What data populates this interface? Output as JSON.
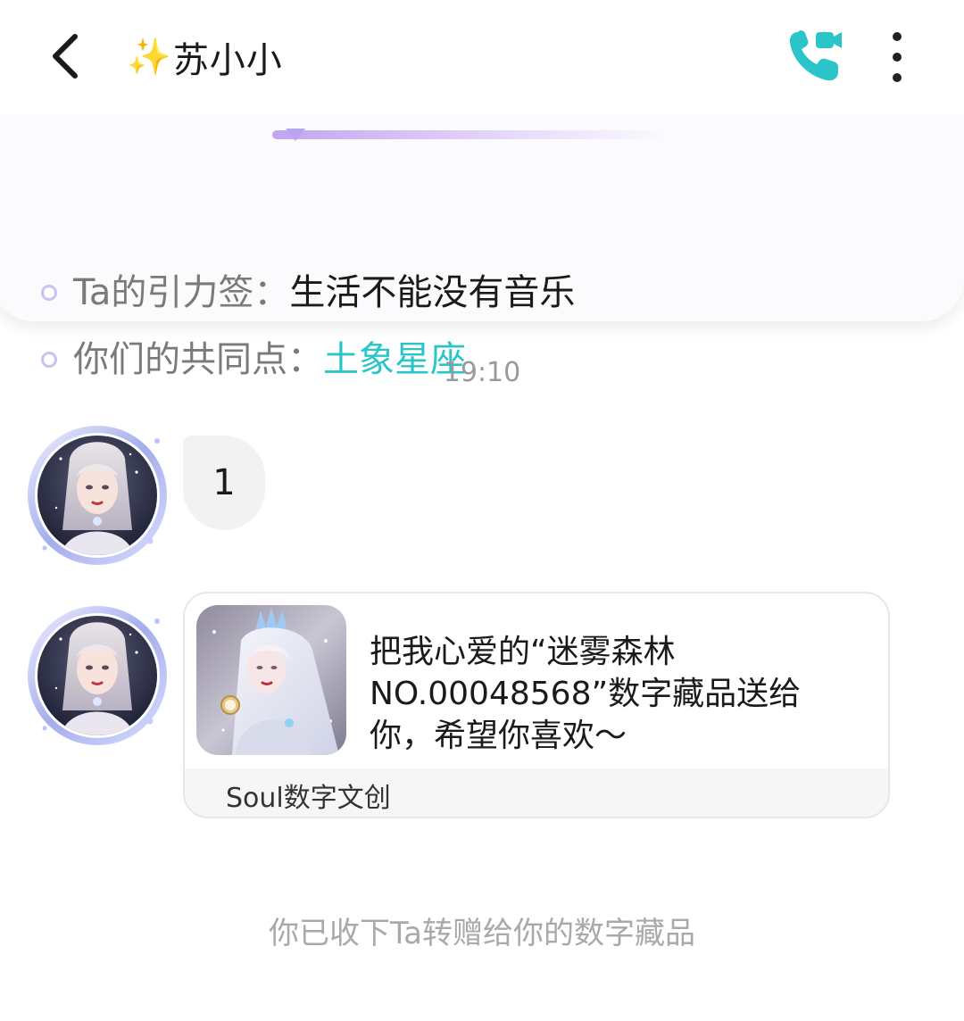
{
  "header": {
    "title_emoji": "✨",
    "title": "苏小小",
    "call_icon": "video-call-icon",
    "more_icon": "more-vertical-icon",
    "back_icon": "chevron-left-icon",
    "accent_color": "#2AC5C8"
  },
  "profile_card": {
    "tag_label": "Ta的引力签：",
    "tag_value": "生活不能没有音乐",
    "common_label": "你们的共同点：",
    "common_value": "土象星座"
  },
  "chat": {
    "timestamp": "19:10",
    "messages": [
      {
        "type": "text",
        "text": "1"
      },
      {
        "type": "gift",
        "text": "把我心爱的“迷雾森林NO.00048568”数字藏品送给你，希望你喜欢～",
        "source": "Soul数字文创"
      }
    ],
    "system_note": "你已收下Ta转赠给你的数字藏品"
  }
}
